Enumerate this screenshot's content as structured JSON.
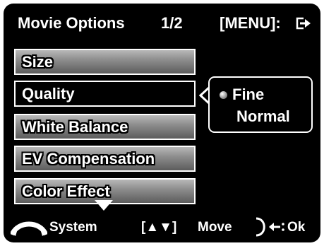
{
  "header": {
    "title": "Movie Options",
    "page": "1/2",
    "menu_hint": "[MENU]:",
    "exit_icon": "exit-arrow-icon"
  },
  "menu": {
    "items": [
      {
        "label": "Size"
      },
      {
        "label": "Quality",
        "selected": true
      },
      {
        "label": "White Balance"
      },
      {
        "label": "EV Compensation"
      },
      {
        "label": "Color Effect"
      }
    ]
  },
  "submenu": {
    "options": [
      {
        "label": "Fine",
        "selected": true
      },
      {
        "label": "Normal"
      }
    ]
  },
  "footer": {
    "system_label": "System",
    "move_keys": "[▲▼]",
    "move_label": "Move",
    "ok_label": "Ok",
    "icons": [
      "more-items-down-arrow-icon",
      "system-mode-dial-icon",
      "ok-control-icon"
    ]
  },
  "colors": {
    "background": "#000000",
    "text": "#ffffff",
    "item_gradient_top": "#b8b8b8",
    "item_gradient_bottom": "#5c5c5c"
  }
}
